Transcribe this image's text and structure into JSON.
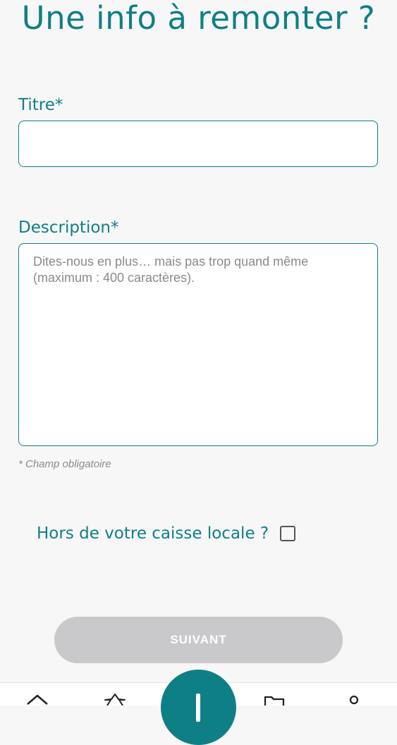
{
  "header": {
    "title": "Une info à remonter ?"
  },
  "form": {
    "title_label": "Titre*",
    "title_value": "",
    "description_label": "Description*",
    "description_placeholder": "Dites-nous en plus… mais pas trop quand même (maximum : 400 caractères).",
    "description_value": "",
    "required_note": "* Champ obligatoire",
    "hors_caisse_label": "Hors de votre caisse locale ?",
    "hors_caisse_checked": false,
    "next_button_label": "SUIVANT"
  },
  "bottom_nav": {
    "items": [
      {
        "icon": "home-icon"
      },
      {
        "icon": "star-icon"
      },
      {
        "icon": "plus-icon"
      },
      {
        "icon": "folder-icon"
      },
      {
        "icon": "profile-icon"
      }
    ]
  },
  "colors": {
    "accent": "#0f7f86",
    "disabled_button": "#c9c9cc",
    "placeholder": "#8a8a8e",
    "background": "#f7f7f8"
  }
}
